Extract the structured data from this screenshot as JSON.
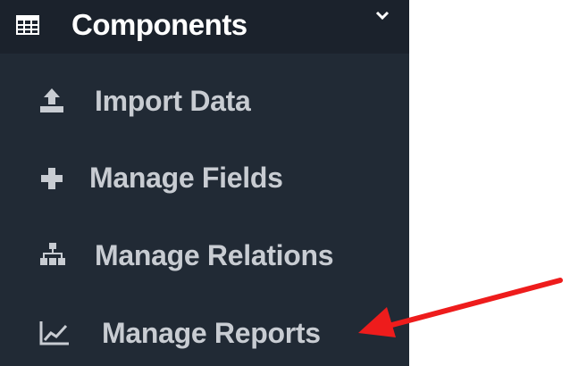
{
  "header": {
    "icon": "table-grid-icon",
    "title": "Components",
    "chevron": "chevron-down-icon"
  },
  "menu": {
    "items": [
      {
        "label": "Import Data",
        "icon": "upload-icon"
      },
      {
        "label": "Manage Fields",
        "icon": "plus-icon"
      },
      {
        "label": "Manage Relations",
        "icon": "sitemap-icon"
      },
      {
        "label": "Manage Reports",
        "icon": "line-chart-icon"
      }
    ]
  },
  "colors": {
    "sidebar_bg": "#212a35",
    "header_bg": "#1b222c",
    "label_text": "#c8ccd2",
    "header_text": "#ffffff",
    "annotation_arrow": "#ee1c1c"
  }
}
